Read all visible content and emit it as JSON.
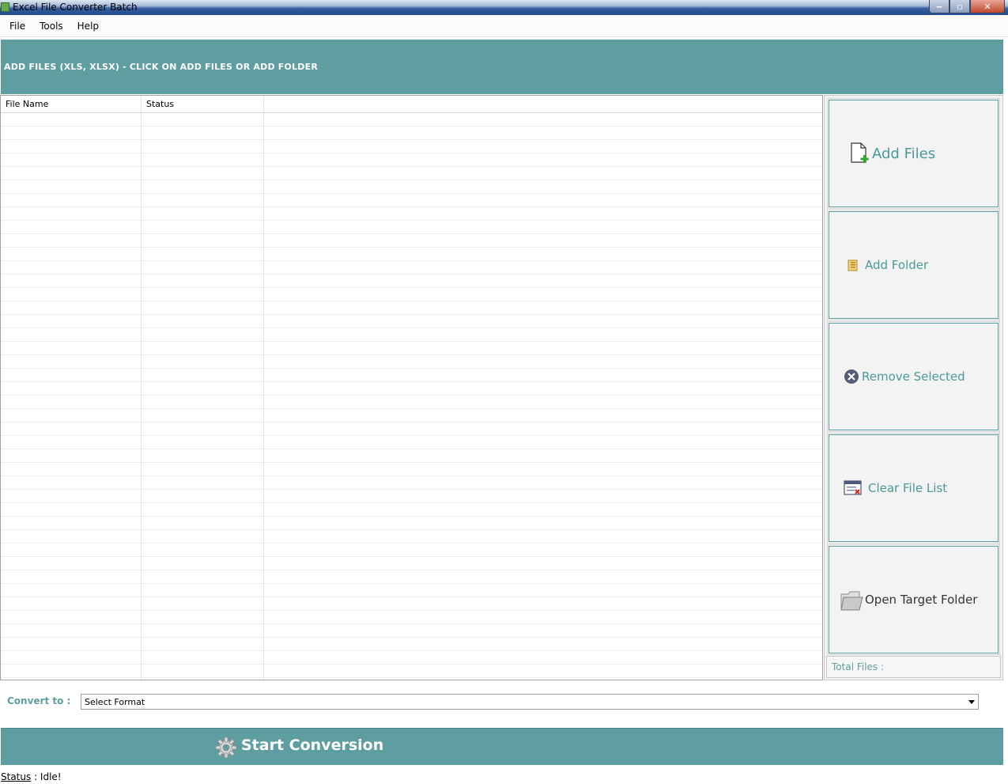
{
  "window": {
    "title": "Excel File Converter Batch",
    "minimize": "‒",
    "restore": "▫",
    "close": "✕"
  },
  "menu": [
    {
      "label": "File"
    },
    {
      "label": "Tools"
    },
    {
      "label": "Help"
    }
  ],
  "banner": {
    "text": "ADD FILES (XLS, XLSX) - CLICK ON ADD FILES OR ADD FOLDER"
  },
  "table": {
    "columns": [
      "File Name",
      "Status",
      ""
    ],
    "rows": []
  },
  "sidebar": {
    "add_files": "Add Files",
    "add_folder": "Add Folder",
    "remove_selected": "Remove Selected",
    "clear_list": "Clear File List",
    "open_target": "Open Target Folder",
    "total_files": "Total Files :"
  },
  "convert": {
    "label": "Convert to :",
    "selected": "Select Format"
  },
  "start": {
    "label": "Start Conversion"
  },
  "status": {
    "key": "Status",
    "sep": " : ",
    "value": "Idle!"
  },
  "colors": {
    "accent": "#5f9ea0",
    "button_text": "#4a9a99"
  },
  "icons": {
    "add_files": "add-file-icon",
    "add_folder": "folder-icon",
    "remove": "remove-circle-icon",
    "clear": "clear-list-icon",
    "open_target": "open-folder-icon",
    "start": "gear-icon"
  }
}
